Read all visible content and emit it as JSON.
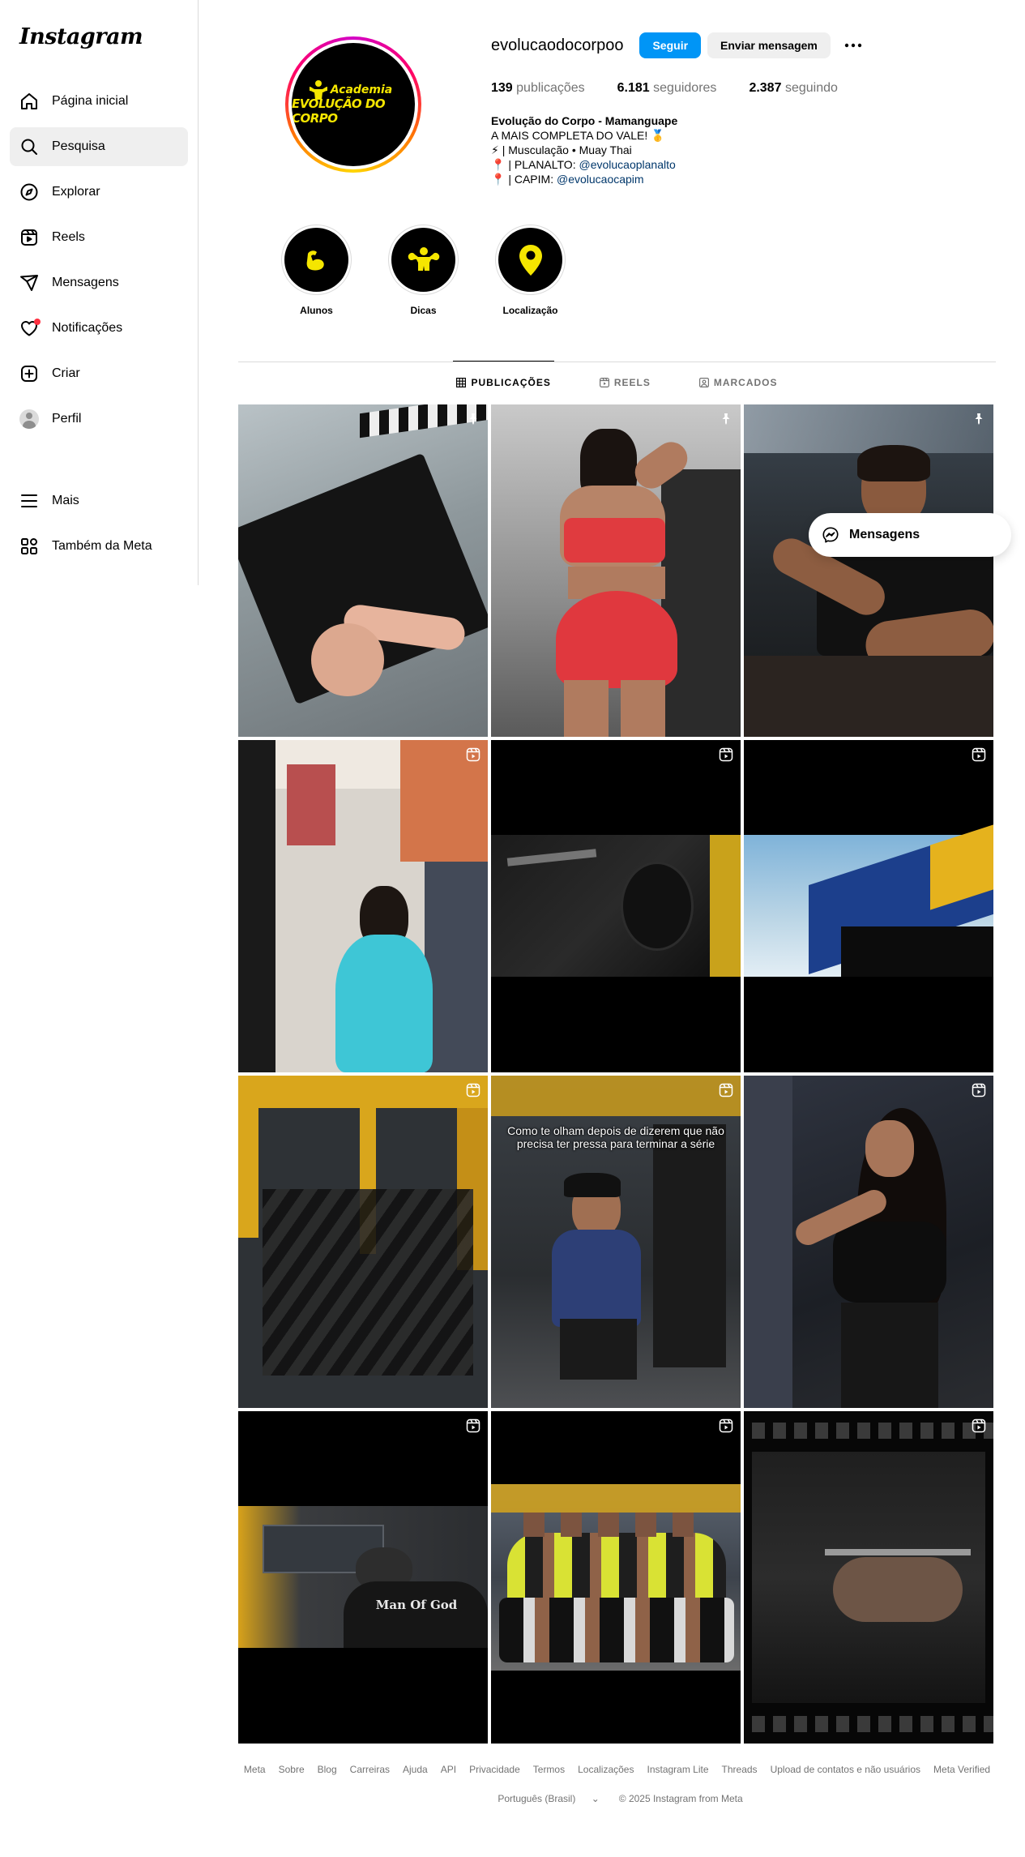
{
  "brand": {
    "logo_text": "Instagram"
  },
  "sidebar": {
    "items": [
      {
        "label": "Página inicial",
        "icon": "home-icon"
      },
      {
        "label": "Pesquisa",
        "icon": "search-icon",
        "active": true
      },
      {
        "label": "Explorar",
        "icon": "compass-icon"
      },
      {
        "label": "Reels",
        "icon": "reels-icon"
      },
      {
        "label": "Mensagens",
        "icon": "send-icon"
      },
      {
        "label": "Notificações",
        "icon": "heart-icon"
      },
      {
        "label": "Criar",
        "icon": "plus-square-icon"
      },
      {
        "label": "Perfil",
        "icon": "avatar"
      }
    ],
    "bottom": [
      {
        "label": "Mais",
        "icon": "menu-icon"
      },
      {
        "label": "Também da Meta",
        "icon": "meta-apps-icon"
      }
    ]
  },
  "profile": {
    "username": "evolucaodocorpoo",
    "follow_label": "Seguir",
    "message_label": "Enviar mensagem",
    "pic_text_1": "Academia",
    "pic_text_2": "EVOLUÇÃO DO CORPO",
    "stats": {
      "posts_count": "139",
      "posts_label": "publicações",
      "followers_count": "6.181",
      "followers_label": "seguidores",
      "following_count": "2.387",
      "following_label": "seguindo"
    },
    "bio": {
      "name": "Evolução do Corpo - Mamanguape",
      "line1": "A MAIS COMPLETA DO VALE! 🥇",
      "line2_emoji": "⚡",
      "line2": "| Musculação • Muay Thai",
      "line3_emoji": "📍",
      "line3_prefix": "| PLANALTO: ",
      "line3_link": "@evolucaoplanalto",
      "line4_emoji": "📍",
      "line4_prefix": "| CAPIM: ",
      "line4_link": "@evolucaocapim"
    }
  },
  "highlights": [
    {
      "label": "Alunos",
      "icon": "flexed-arm-icon"
    },
    {
      "label": "Dicas",
      "icon": "bodybuilder-icon"
    },
    {
      "label": "Localização",
      "icon": "location-pin-icon"
    }
  ],
  "tabs": [
    {
      "label": "PUBLICAÇÕES",
      "icon": "grid-icon",
      "active": true
    },
    {
      "label": "REELS",
      "icon": "reels-icon"
    },
    {
      "label": "MARCADOS",
      "icon": "tagged-icon"
    }
  ],
  "posts": [
    {
      "type": "pinned"
    },
    {
      "type": "pinned"
    },
    {
      "type": "pinned"
    },
    {
      "type": "reel"
    },
    {
      "type": "reel"
    },
    {
      "type": "reel"
    },
    {
      "type": "reel"
    },
    {
      "type": "reel",
      "caption": "Como te olham depois de dizerem que não precisa ter pressa para terminar a série"
    },
    {
      "type": "reel"
    },
    {
      "type": "reel",
      "shirt_text": "Man Of God"
    },
    {
      "type": "reel"
    },
    {
      "type": "reel"
    }
  ],
  "floating_messages": {
    "label": "Mensagens"
  },
  "footer": {
    "links": [
      "Meta",
      "Sobre",
      "Blog",
      "Carreiras",
      "Ajuda",
      "API",
      "Privacidade",
      "Termos",
      "Localizações",
      "Instagram Lite",
      "Threads",
      "Upload de contatos e não usuários",
      "Meta Verified"
    ],
    "language": "Português (Brasil)",
    "copyright": "© 2025 Instagram from Meta"
  },
  "colors": {
    "accent": "#0095f6",
    "link": "#00376b",
    "notification": "#ff3040",
    "brand_yellow": "#f5e600"
  }
}
